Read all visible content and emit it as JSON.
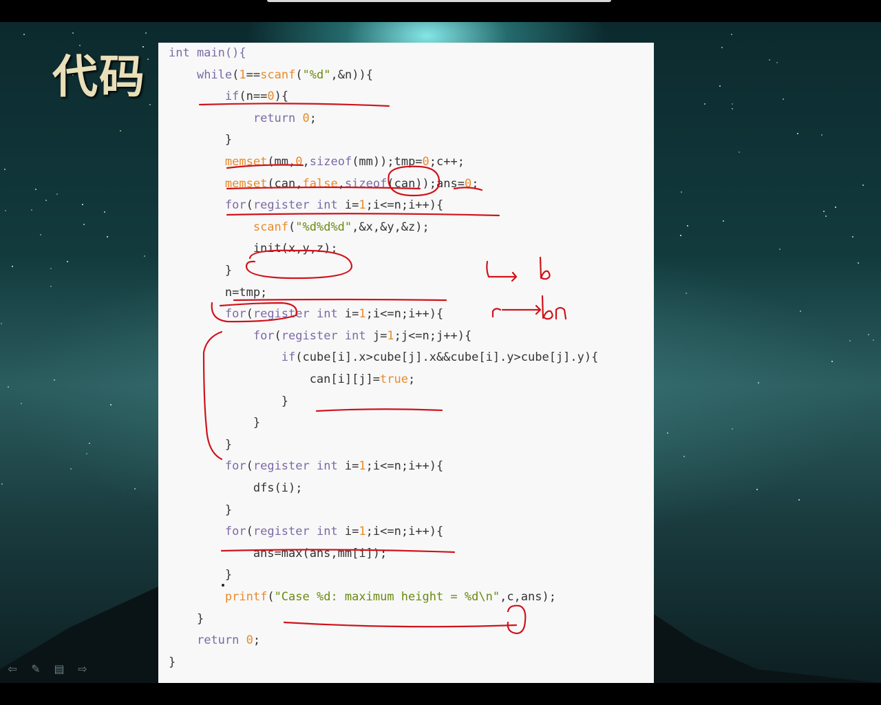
{
  "slide": {
    "title": "代码",
    "code_lines": [
      [
        {
          "t": "int main(){",
          "c": "kw"
        }
      ],
      [
        {
          "t": "    "
        },
        {
          "t": "while",
          "c": "kw"
        },
        {
          "t": "("
        },
        {
          "t": "1",
          "c": "num"
        },
        {
          "t": "=="
        },
        {
          "t": "scanf",
          "c": "num"
        },
        {
          "t": "("
        },
        {
          "t": "\"%d\"",
          "c": "str"
        },
        {
          "t": ",&n)){"
        }
      ],
      [
        {
          "t": "        "
        },
        {
          "t": "if",
          "c": "kw"
        },
        {
          "t": "(n=="
        },
        {
          "t": "0",
          "c": "num"
        },
        {
          "t": "){"
        }
      ],
      [
        {
          "t": "            "
        },
        {
          "t": "return",
          "c": "kw"
        },
        {
          "t": " "
        },
        {
          "t": "0",
          "c": "num"
        },
        {
          "t": ";"
        }
      ],
      [
        {
          "t": "        }"
        }
      ],
      [
        {
          "t": "        "
        },
        {
          "t": "memset",
          "c": "num"
        },
        {
          "t": "(mm,"
        },
        {
          "t": "0",
          "c": "num"
        },
        {
          "t": ","
        },
        {
          "t": "sizeof",
          "c": "kw"
        },
        {
          "t": "(mm));tmp="
        },
        {
          "t": "0",
          "c": "num"
        },
        {
          "t": ";c++;"
        }
      ],
      [
        {
          "t": "        "
        },
        {
          "t": "memset",
          "c": "num"
        },
        {
          "t": "(can,"
        },
        {
          "t": "false",
          "c": "num"
        },
        {
          "t": ","
        },
        {
          "t": "sizeof",
          "c": "kw"
        },
        {
          "t": "(can));ans="
        },
        {
          "t": "0",
          "c": "num"
        },
        {
          "t": ";"
        }
      ],
      [
        {
          "t": "        "
        },
        {
          "t": "for",
          "c": "kw"
        },
        {
          "t": "("
        },
        {
          "t": "register int",
          "c": "kw"
        },
        {
          "t": " i="
        },
        {
          "t": "1",
          "c": "num"
        },
        {
          "t": ";i<=n;i++){"
        }
      ],
      [
        {
          "t": "            "
        },
        {
          "t": "scanf",
          "c": "num"
        },
        {
          "t": "("
        },
        {
          "t": "\"%d%d%d\"",
          "c": "str"
        },
        {
          "t": ",&x,&y,&z);"
        }
      ],
      [
        {
          "t": "            init(x,y,z);"
        }
      ],
      [
        {
          "t": "        }"
        }
      ],
      [
        {
          "t": "        n=tmp;"
        }
      ],
      [
        {
          "t": "        "
        },
        {
          "t": "for",
          "c": "kw"
        },
        {
          "t": "("
        },
        {
          "t": "register int",
          "c": "kw"
        },
        {
          "t": " i="
        },
        {
          "t": "1",
          "c": "num"
        },
        {
          "t": ";i<=n;i++){"
        }
      ],
      [
        {
          "t": "            "
        },
        {
          "t": "for",
          "c": "kw"
        },
        {
          "t": "("
        },
        {
          "t": "register int",
          "c": "kw"
        },
        {
          "t": " j="
        },
        {
          "t": "1",
          "c": "num"
        },
        {
          "t": ";j<=n;j++){"
        }
      ],
      [
        {
          "t": "                "
        },
        {
          "t": "if",
          "c": "kw"
        },
        {
          "t": "(cube[i].x>cube[j].x&&cube[i].y>cube[j].y){"
        }
      ],
      [
        {
          "t": "                    can[i][j]="
        },
        {
          "t": "true",
          "c": "num"
        },
        {
          "t": ";"
        }
      ],
      [
        {
          "t": "                }"
        }
      ],
      [
        {
          "t": "            }"
        }
      ],
      [
        {
          "t": "        }"
        }
      ],
      [
        {
          "t": "        "
        },
        {
          "t": "for",
          "c": "kw"
        },
        {
          "t": "("
        },
        {
          "t": "register int",
          "c": "kw"
        },
        {
          "t": " i="
        },
        {
          "t": "1",
          "c": "num"
        },
        {
          "t": ";i<=n;i++){"
        }
      ],
      [
        {
          "t": "            dfs(i);"
        }
      ],
      [
        {
          "t": "        }"
        }
      ],
      [
        {
          "t": "        "
        },
        {
          "t": "for",
          "c": "kw"
        },
        {
          "t": "("
        },
        {
          "t": "register int",
          "c": "kw"
        },
        {
          "t": " i="
        },
        {
          "t": "1",
          "c": "num"
        },
        {
          "t": ";i<=n;i++){"
        }
      ],
      [
        {
          "t": "            ans=max(ans,mm[i]);"
        }
      ],
      [
        {
          "t": "        }"
        }
      ],
      [
        {
          "t": "        "
        },
        {
          "t": "printf",
          "c": "num"
        },
        {
          "t": "("
        },
        {
          "t": "\"Case %d: maximum height = %d\\n\"",
          "c": "str"
        },
        {
          "t": ",c,ans);"
        }
      ],
      [
        {
          "t": "    }"
        }
      ],
      [
        {
          "t": "    "
        },
        {
          "t": "return",
          "c": "kw"
        },
        {
          "t": " "
        },
        {
          "t": "0",
          "c": "num"
        },
        {
          "t": ";"
        }
      ],
      [
        {
          "t": "}"
        }
      ]
    ]
  },
  "colors": {
    "keyword": "#7a6aa6",
    "literal": "#e88a2a",
    "string": "#6a8a10",
    "ink": "#d0121a"
  },
  "toolbar": {
    "prev_icon": "arrow-left-icon",
    "pen_icon": "pen-icon",
    "menu_icon": "menu-icon",
    "next_icon": "arrow-right-icon"
  }
}
